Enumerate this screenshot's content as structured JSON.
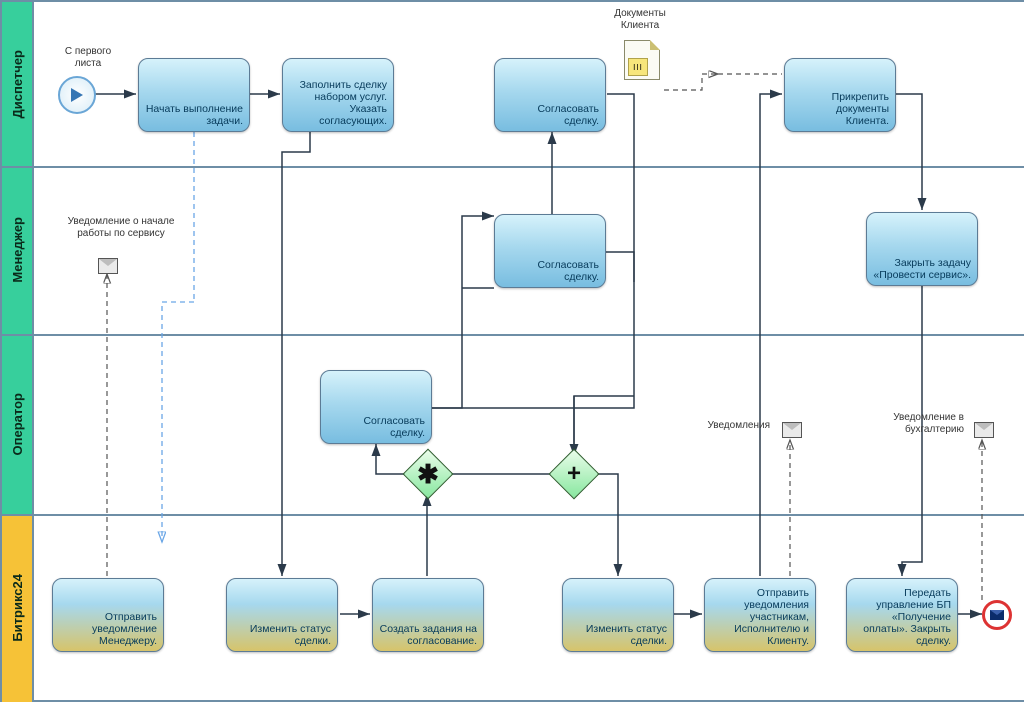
{
  "lanes": {
    "dispatcher": "Диспетчер",
    "manager": "Менеджер",
    "operator": "Оператор",
    "bitrix": "Битрикс24"
  },
  "tasks": {
    "t1": "Начать выполнение задачи.",
    "t2": "Заполнить сделку набором услуг. Указать согласующих.",
    "t3": "Согласовать сделку.",
    "t4": "Прикрепить документы Клиента.",
    "t5": "Согласовать сделку.",
    "t6": "Закрыть задачу «Провести сервис».",
    "t7": "Согласовать сделку.",
    "b1": "Отправить уведомление Менеджеру.",
    "b2": "Изменить статус сделки.",
    "b3": "Создать задания на согласование.",
    "b4": "Изменить статус сделки.",
    "b5": "Отправить уведомления участникам, Исполнителю и Клиенту.",
    "b6": "Передать управление БП «Получение оплаты». Закрыть сделку."
  },
  "labels": {
    "start": "С первого листа",
    "docTitle": "Документы Клиента",
    "notifyStart": "Уведомление о начале работы по сервису",
    "notifications": "Уведомления",
    "notifyAccounting": "Уведомление в бухгалтерию"
  },
  "icons": {
    "docBars": "III"
  }
}
